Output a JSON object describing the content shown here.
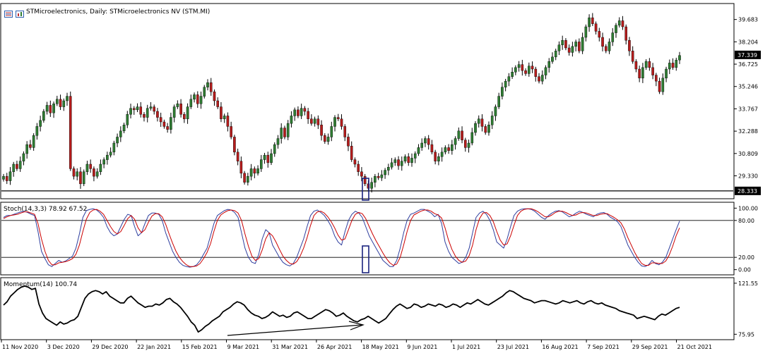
{
  "header": {
    "title": "STMicroelectronics, Daily:  STMicroelectronics NV (STM.MI)"
  },
  "icons": [
    "window-list-icon",
    "chart-bars-icon"
  ],
  "colors": {
    "bull": "#2e7d32",
    "bear": "#b71c1c",
    "stoch_main": "#2f3f9f",
    "stoch_signal": "#cc0000",
    "momentum": "#000000",
    "highlight": "#1a237e"
  },
  "chart_data": [
    {
      "type": "candlestick",
      "panel": "price",
      "y_ticks": [
        "39.683",
        "38.204",
        "36.725",
        "35.246",
        "33.767",
        "32.288",
        "30.809",
        "29.330"
      ],
      "ylim": [
        28.0,
        40.6
      ],
      "current_price_label": "37.339",
      "horizontal_line_label": "28.333",
      "horizontal_line_value": 28.333,
      "close_series": [
        29.3,
        29.0,
        29.6,
        30.1,
        29.8,
        30.3,
        30.8,
        31.4,
        31.2,
        32.0,
        32.6,
        33.0,
        33.6,
        34.0,
        33.5,
        34.1,
        34.4,
        33.9,
        34.3,
        34.6,
        29.8,
        29.3,
        29.6,
        28.8,
        29.6,
        30.1,
        29.8,
        29.3,
        29.6,
        30.1,
        30.4,
        30.7,
        30.9,
        31.5,
        31.9,
        32.3,
        32.7,
        33.4,
        33.8,
        33.7,
        33.9,
        33.4,
        33.2,
        33.8,
        33.9,
        33.6,
        33.2,
        32.9,
        32.6,
        32.4,
        33.2,
        33.9,
        34.1,
        33.4,
        33.1,
        33.9,
        34.4,
        34.7,
        34.1,
        34.6,
        35.2,
        35.5,
        34.9,
        34.3,
        33.9,
        33.1,
        33.3,
        32.6,
        31.9,
        30.9,
        30.3,
        29.5,
        28.9,
        29.3,
        29.8,
        29.5,
        29.8,
        30.4,
        30.7,
        30.2,
        30.8,
        31.4,
        31.8,
        32.5,
        31.9,
        32.8,
        33.3,
        33.7,
        33.3,
        33.8,
        33.6,
        33.1,
        32.8,
        33.1,
        32.7,
        32.0,
        31.6,
        31.9,
        32.6,
        33.2,
        33.1,
        32.6,
        31.9,
        31.3,
        30.4,
        30.1,
        29.6,
        29.3,
        28.8,
        28.5,
        28.9,
        29.3,
        29.2,
        29.4,
        29.7,
        29.9,
        30.2,
        30.4,
        30.0,
        30.3,
        30.6,
        30.2,
        30.5,
        30.8,
        31.2,
        31.5,
        31.8,
        31.4,
        30.9,
        30.3,
        30.6,
        30.9,
        31.2,
        31.0,
        31.4,
        31.8,
        32.3,
        31.7,
        31.2,
        31.5,
        32.2,
        32.8,
        33.1,
        32.6,
        32.2,
        32.7,
        33.3,
        33.9,
        34.6,
        35.2,
        35.6,
        35.9,
        36.2,
        36.5,
        36.7,
        36.3,
        36.1,
        36.6,
        36.4,
        35.9,
        35.6,
        36.0,
        36.5,
        36.9,
        37.2,
        37.6,
        38.0,
        38.3,
        37.8,
        37.5,
        37.9,
        38.2,
        37.6,
        38.5,
        39.2,
        39.8,
        39.4,
        38.9,
        38.5,
        37.9,
        37.6,
        38.2,
        38.8,
        39.3,
        39.6,
        39.2,
        38.3,
        37.6,
        36.9,
        36.4,
        35.8,
        36.5,
        36.9,
        36.5,
        36.0,
        35.6,
        34.9,
        35.8,
        36.4,
        36.8,
        36.5,
        37.0,
        37.3
      ]
    },
    {
      "type": "line",
      "panel": "stochastic",
      "title": "Stoch(14,3,3) 78.92 67.52",
      "y_ticks": [
        "100.00",
        "80.00",
        "20.00",
        "0.00"
      ],
      "levels": [
        80,
        20
      ],
      "ylim": [
        -5,
        105
      ],
      "series": [
        {
          "name": "main",
          "values": [
            85,
            88,
            88,
            90,
            92,
            94,
            95,
            93,
            90,
            88,
            62,
            30,
            18,
            8,
            5,
            10,
            15,
            12,
            14,
            18,
            22,
            35,
            58,
            85,
            96,
            98,
            99,
            97,
            92,
            85,
            70,
            60,
            55,
            58,
            70,
            82,
            90,
            88,
            70,
            55,
            60,
            75,
            88,
            92,
            92,
            90,
            80,
            60,
            45,
            30,
            20,
            12,
            7,
            5,
            4,
            5,
            8,
            15,
            25,
            35,
            55,
            75,
            88,
            92,
            96,
            98,
            97,
            93,
            85,
            60,
            35,
            20,
            12,
            10,
            25,
            50,
            65,
            60,
            40,
            30,
            20,
            12,
            8,
            6,
            10,
            20,
            35,
            50,
            70,
            88,
            95,
            97,
            93,
            88,
            80,
            70,
            55,
            45,
            40,
            62,
            80,
            90,
            95,
            92,
            85,
            70,
            55,
            45,
            35,
            25,
            15,
            10,
            5,
            5,
            15,
            35,
            60,
            80,
            90,
            92,
            95,
            98,
            98,
            95,
            92,
            86,
            90,
            75,
            45,
            30,
            20,
            15,
            10,
            12,
            20,
            35,
            60,
            85,
            92,
            95,
            90,
            80,
            65,
            45,
            40,
            35,
            50,
            70,
            88,
            95,
            98,
            99,
            99,
            98,
            95,
            90,
            85,
            82,
            88,
            92,
            95,
            96,
            94,
            90,
            86,
            88,
            92,
            95,
            93,
            90,
            88,
            86,
            90,
            92,
            93,
            90,
            85,
            82,
            78,
            70,
            55,
            40,
            30,
            20,
            12,
            6,
            5,
            8,
            15,
            10,
            8,
            12,
            20,
            35,
            50,
            65,
            79
          ]
        },
        {
          "name": "signal",
          "values": [
            83,
            86,
            88,
            89,
            90,
            92,
            94,
            94,
            92,
            90,
            75,
            50,
            30,
            15,
            8,
            8,
            11,
            12,
            13,
            15,
            18,
            25,
            40,
            62,
            82,
            93,
            97,
            98,
            95,
            90,
            80,
            70,
            62,
            58,
            62,
            72,
            83,
            88,
            82,
            68,
            60,
            65,
            77,
            87,
            91,
            91,
            86,
            74,
            58,
            43,
            30,
            20,
            13,
            8,
            5,
            5,
            6,
            10,
            18,
            28,
            42,
            62,
            80,
            89,
            93,
            96,
            97,
            96,
            92,
            80,
            58,
            38,
            22,
            15,
            18,
            32,
            50,
            60,
            55,
            45,
            33,
            22,
            15,
            10,
            9,
            13,
            22,
            35,
            52,
            72,
            88,
            94,
            95,
            92,
            86,
            78,
            68,
            56,
            48,
            50,
            65,
            80,
            90,
            93,
            91,
            83,
            70,
            58,
            47,
            37,
            27,
            18,
            11,
            7,
            9,
            20,
            40,
            62,
            80,
            89,
            92,
            95,
            97,
            97,
            95,
            91,
            89,
            84,
            68,
            48,
            33,
            22,
            15,
            12,
            14,
            23,
            40,
            65,
            83,
            92,
            93,
            88,
            78,
            62,
            48,
            40,
            42,
            55,
            72,
            88,
            95,
            98,
            99,
            99,
            97,
            94,
            90,
            86,
            86,
            89,
            93,
            95,
            95,
            93,
            90,
            88,
            89,
            92,
            93,
            92,
            90,
            88,
            88,
            90,
            91,
            91,
            88,
            85,
            81,
            76,
            66,
            52,
            40,
            28,
            18,
            10,
            7,
            7,
            11,
            11,
            10,
            10,
            14,
            24,
            38,
            55,
            68
          ]
        }
      ]
    },
    {
      "type": "line",
      "panel": "momentum",
      "title": "Momentum(14) 100.74",
      "y_ticks": [
        "121.55",
        "75.95"
      ],
      "ylim": [
        73,
        124
      ],
      "series": [
        {
          "name": "momentum",
          "values": [
            102,
            105,
            110,
            113,
            116,
            118,
            119,
            118,
            116,
            117,
            103,
            95,
            90,
            88,
            86,
            84,
            87,
            85,
            86,
            88,
            89,
            92,
            100,
            108,
            112,
            114,
            115,
            114,
            112,
            114,
            110,
            108,
            106,
            104,
            104,
            108,
            110,
            107,
            104,
            102,
            100,
            101,
            101,
            103,
            102,
            104,
            107,
            108,
            105,
            103,
            100,
            96,
            92,
            87,
            84,
            78,
            80,
            83,
            85,
            88,
            90,
            92,
            96,
            98,
            100,
            103,
            105,
            104,
            102,
            98,
            95,
            93,
            92,
            90,
            91,
            93,
            96,
            94,
            92,
            93,
            91,
            92,
            95,
            96,
            94,
            92,
            90,
            90,
            92,
            94,
            96,
            98,
            97,
            95,
            92,
            93,
            95,
            92,
            90,
            88,
            87,
            89,
            90,
            92,
            90,
            88,
            86,
            88,
            90,
            94,
            98,
            101,
            103,
            101,
            99,
            100,
            103,
            102,
            100,
            101,
            103,
            102,
            101,
            103,
            102,
            100,
            101,
            103,
            102,
            100,
            102,
            104,
            103,
            105,
            107,
            105,
            103,
            102,
            104,
            106,
            108,
            110,
            113,
            115,
            114,
            112,
            110,
            108,
            107,
            106,
            104,
            105,
            106,
            106,
            105,
            104,
            103,
            104,
            106,
            105,
            104,
            105,
            106,
            104,
            103,
            105,
            106,
            104,
            103,
            104,
            102,
            101,
            100,
            99,
            97,
            96,
            95,
            94,
            93,
            90,
            91,
            92,
            91,
            90,
            89,
            92,
            94,
            93,
            95,
            97,
            99,
            100
          ]
        }
      ]
    }
  ],
  "x_axis": {
    "labels": [
      "11 Nov 2020",
      "3 Dec 2020",
      "29 Dec 2020",
      "22 Jan 2021",
      "15 Feb 2021",
      "9 Mar 2021",
      "31 Mar 2021",
      "26 Apr 2021",
      "18 May 2021",
      "9 Jun 2021",
      "1 Jul 2021",
      "23 Jul 2021",
      "16 Aug 2021",
      "7 Sep 2021",
      "29 Sep 2021",
      "21 Oct 2021"
    ]
  }
}
